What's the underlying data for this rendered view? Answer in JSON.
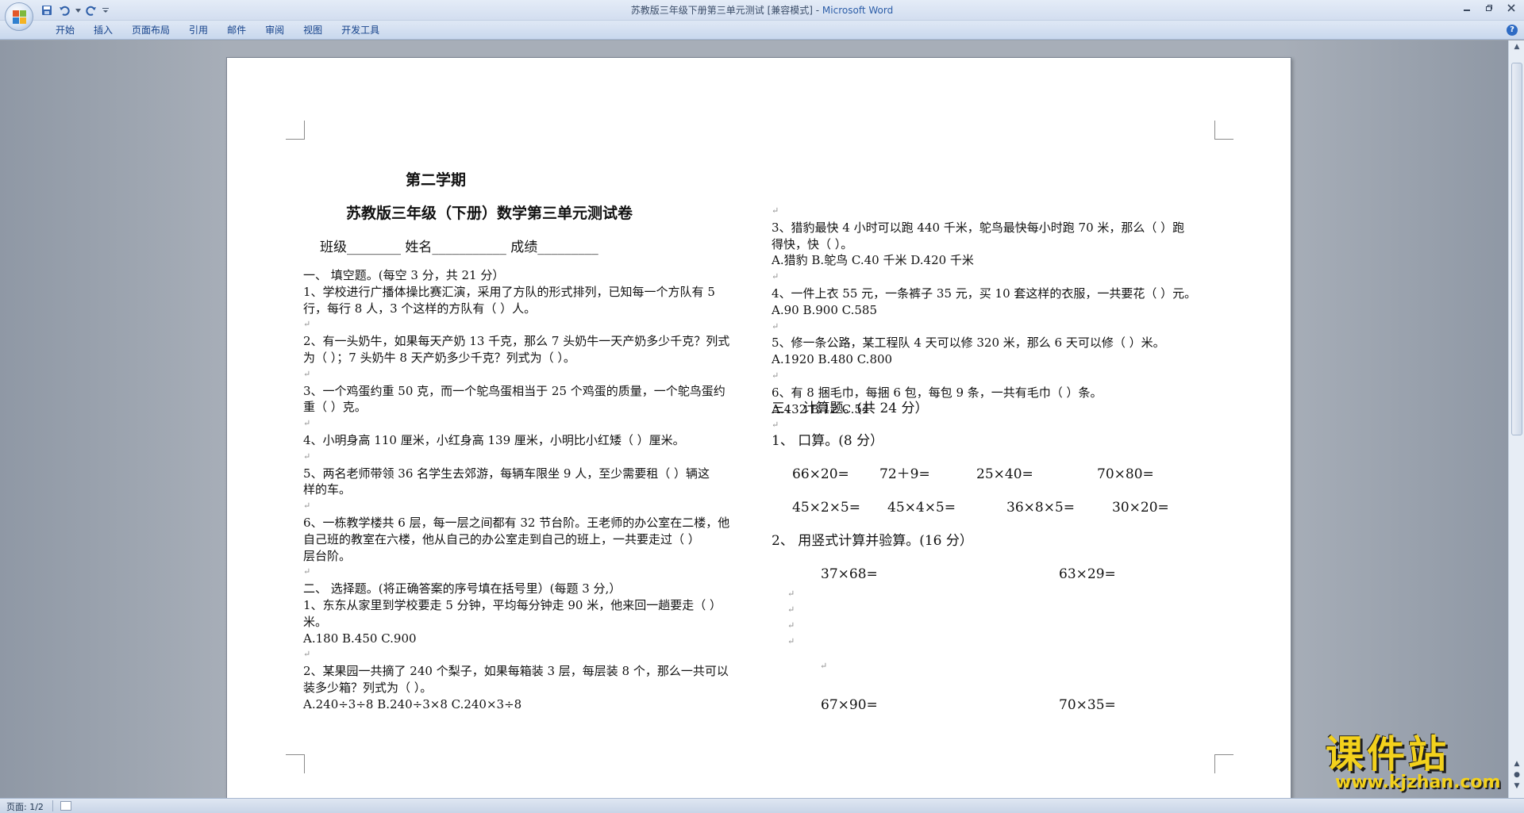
{
  "window": {
    "title_main": "苏教版三年级下册第三单元测试 [兼容模式] - ",
    "title_app": "Microsoft Word"
  },
  "ribbon": {
    "tabs": [
      "开始",
      "插入",
      "页面布局",
      "引用",
      "邮件",
      "审阅",
      "视图",
      "开发工具"
    ]
  },
  "status": {
    "page": "页面: 1/2"
  },
  "watermark": {
    "line1": "课件站",
    "line2": "www.kjzhan.com"
  },
  "icons": {
    "office": "office-logo-icon",
    "save": "save-icon",
    "undo": "undo-icon",
    "redo": "redo-icon",
    "customize": "chevron-down-icon",
    "help": "help-icon"
  },
  "doc": {
    "semester": "第二学期",
    "title": "苏教版三年级（下册）数学第三单元测试卷",
    "info_line": "班级________    姓名___________    成绩_________",
    "left": [
      "一、    填空题。(每空 3 分，共 21 分）",
      "1、学校进行广播体操比赛汇演，采用了方队的形式排列，已知每一个方队有 5",
      "行，每行 8 人，3 个这样的方队有（    ）人。",
      "",
      "2、有一头奶牛，如果每天产奶 13 千克，那么 7 头奶牛一天产奶多少千克？列式",
      "为（          ）；7 头奶牛 8 天产奶多少千克？列式为（          ）。",
      "",
      "3、一个鸡蛋约重 50 克，而一个鸵鸟蛋相当于 25 个鸡蛋的质量，一个鸵鸟蛋约",
      "重（    ）克。",
      "",
      "4、小明身高 110 厘米，小红身高 139 厘米，小明比小红矮（     ）厘米。",
      "",
      "5、两名老师带领 36 名学生去郊游，每辆车限坐 9 人，至少需要租（     ）辆这",
      "样的车。",
      "",
      "6、一栋教学楼共 6 层，每一层之间都有 32 节台阶。王老师的办公室在二楼，他",
      "自己班的教室在六楼，他从自己的办公室走到自己的班上，一共要走过（     ）",
      "层台阶。",
      "",
      "二、    选择题。(将正确答案的序号填在括号里）(每题 3 分,）",
      "1、东东从家里到学校要走 5 分钟，平均每分钟走 90 米，他来回一趟要走（     ）",
      "米。",
      "    A.180                  B.450                    C.900",
      "",
      "2、某果园一共摘了 240 个梨子，如果每箱装 3 层，每层装 8 个，那么一共可以",
      "装多少箱？列式为（     ）。",
      "    A.240÷3÷8                    B.240÷3×8                    C.240×3÷8"
    ],
    "right": [
      "",
      "3、猎豹最快 4 小时可以跑 440 千米，鸵鸟最快每小时跑 70 米，那么（     ）跑",
      "得快，快（     ）。",
      "   A.猎豹                B.鸵鸟                C.40 千米                D.420 千米",
      "",
      "4、一件上衣 55 元，一条裤子 35 元，买 10 套这样的衣服，一共要花（     ）元。",
      "      A.90                         B.900                         C.585",
      "",
      "5、修一条公路，某工程队 4 天可以修 320 米，那么 6 天可以修（     ）米。",
      "       A.1920                      B.480                         C.800",
      "",
      "6、有 8 捆毛巾，每捆 6 包，每包 9 条，一共有毛巾（     ）条。",
      "       A.432                       B.12                     C.54",
      ""
    ],
    "calc_title": "三、    计算题。(共 24 分）",
    "oral_title": "1、      口算。(8 分）",
    "oral_row1": [
      "66×20=",
      "72＋9=",
      "25×40=",
      "70×80="
    ],
    "oral_row2": [
      "45×2×5=",
      "45×4×5=",
      "36×8×5=",
      "30×20="
    ],
    "vertical_title": "2、      用竖式计算并验算。(16 分）",
    "vertical_row1": [
      "37×68=",
      "63×29="
    ],
    "vertical_row2": [
      "67×90=",
      "70×35="
    ]
  }
}
